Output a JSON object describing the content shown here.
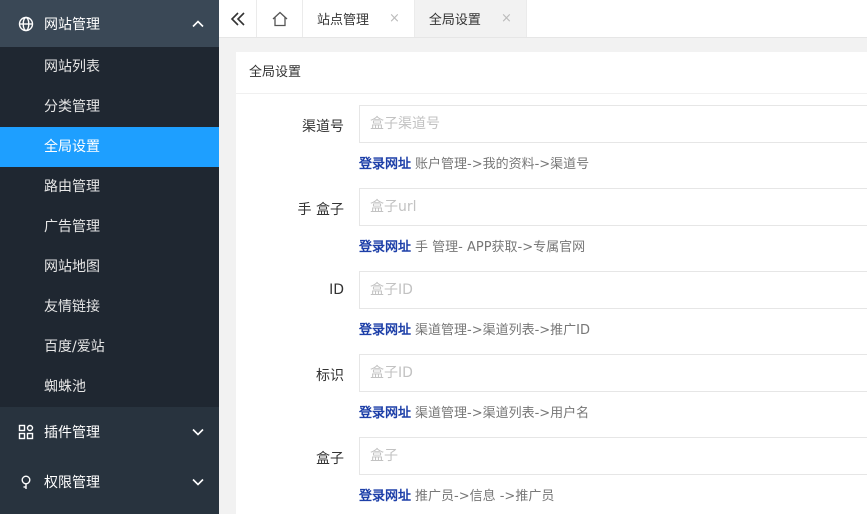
{
  "sidebar": {
    "group_site": {
      "label": "网站管理"
    },
    "items": [
      {
        "label": "网站列表"
      },
      {
        "label": "分类管理"
      },
      {
        "label": "全局设置"
      },
      {
        "label": "路由管理"
      },
      {
        "label": "广告管理"
      },
      {
        "label": "网站地图"
      },
      {
        "label": "友情链接"
      },
      {
        "label": "百度/爱站"
      },
      {
        "label": "蜘蛛池"
      }
    ],
    "active_index": 2,
    "group_plugins": {
      "label": "插件管理"
    },
    "group_perms": {
      "label": "权限管理"
    }
  },
  "tabs": [
    {
      "label": "站点管理",
      "close": "×"
    },
    {
      "label": "全局设置",
      "close": "×"
    }
  ],
  "panel": {
    "title": "全局设置",
    "fields": [
      {
        "label": "渠道号",
        "placeholder": "盒子渠道号",
        "link": "登录网址",
        "hint": "账户管理->我的资料->渠道号"
      },
      {
        "label": "手 盒子",
        "placeholder": "盒子url",
        "link": "登录网址",
        "hint": "手 管理- APP获取->专属官网"
      },
      {
        "label": "ID",
        "placeholder": "盒子ID",
        "link": "登录网址",
        "hint": "渠道管理->渠道列表->推广ID"
      },
      {
        "label": "标识",
        "placeholder": "盒子ID",
        "link": "登录网址",
        "hint": "渠道管理->渠道列表->用户名"
      },
      {
        "label": "盒子",
        "placeholder": "盒子",
        "link": "登录网址",
        "hint": "推广员->信息 ->推广员"
      }
    ]
  },
  "colors": {
    "sidebar_bg": "#28333e",
    "active_item": "#1e9fff",
    "link": "#1d3fa8"
  }
}
